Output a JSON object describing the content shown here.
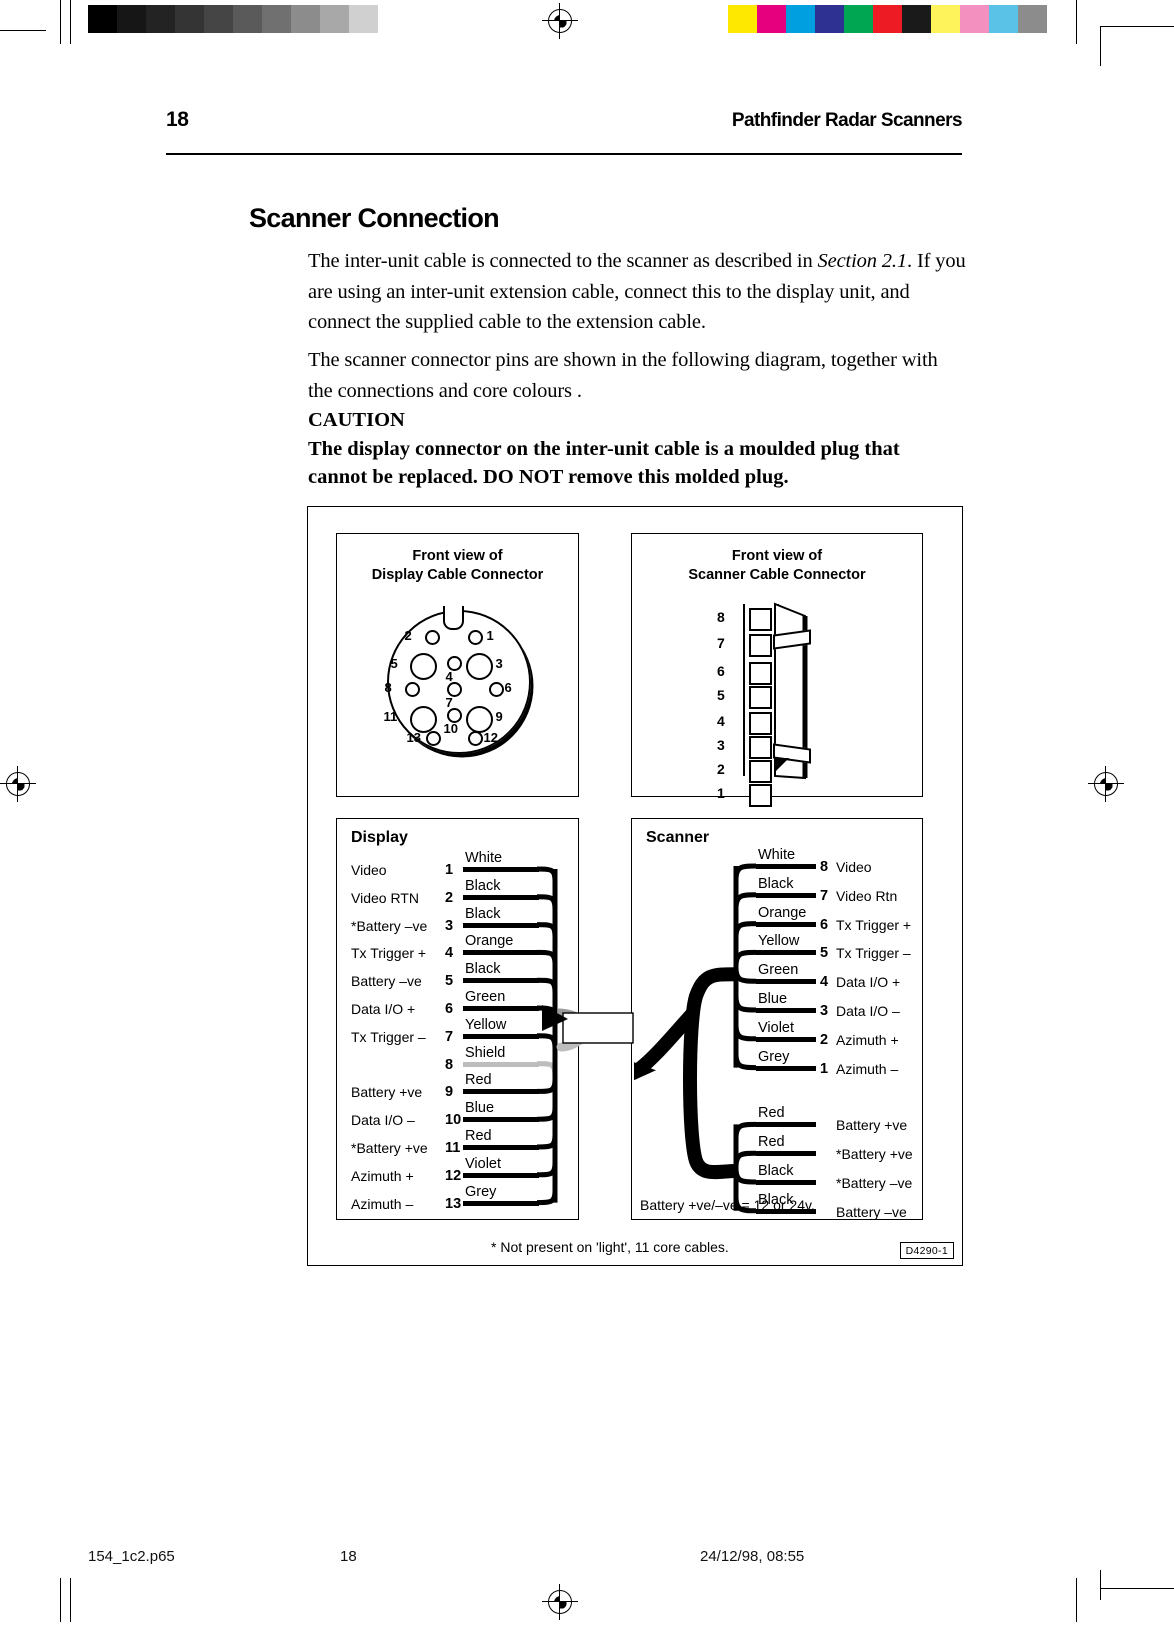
{
  "header": {
    "page_number": "18",
    "running_head": "Pathfinder Radar Scanners"
  },
  "section": {
    "title": "Scanner Connection",
    "paragraph_1_a": "The inter-unit cable is connected to the scanner as described in ",
    "paragraph_1_italic": "Section 2.1",
    "paragraph_1_b": ". If you are using an inter-unit extension cable, connect this to the display unit, and connect the supplied cable to the extension cable.",
    "paragraph_2": "The scanner connector pins  are shown in the following diagram, together with the connections and core colours .",
    "caution_heading": "CAUTION",
    "caution_line_1": "The display connector on the inter-unit cable is a moulded plug that",
    "caution_line_2": "cannot be replaced. DO NOT remove this molded plug."
  },
  "figure": {
    "display_connector": {
      "title_line_1": "Front view of",
      "title_line_2": "Display Cable Connector",
      "pins": [
        "1",
        "2",
        "3",
        "4",
        "5",
        "6",
        "7",
        "8",
        "9",
        "10",
        "11",
        "12",
        "13"
      ]
    },
    "scanner_connector": {
      "title_line_1": "Front view of",
      "title_line_2": "Scanner Cable Connector",
      "pins": [
        "8",
        "7",
        "6",
        "5",
        "4",
        "3",
        "2",
        "1"
      ]
    },
    "display_block": {
      "title": "Display",
      "rows": [
        {
          "signal": "Video",
          "pin": "1",
          "colour": "White"
        },
        {
          "signal": "Video RTN",
          "pin": "2",
          "colour": "Black"
        },
        {
          "signal": "*Battery –ve",
          "pin": "3",
          "colour": "Black"
        },
        {
          "signal": "Tx Trigger +",
          "pin": "4",
          "colour": "Orange"
        },
        {
          "signal": "Battery –ve",
          "pin": "5",
          "colour": "Black"
        },
        {
          "signal": "Data I/O +",
          "pin": "6",
          "colour": "Green"
        },
        {
          "signal": "Tx Trigger –",
          "pin": "7",
          "colour": "Yellow"
        },
        {
          "signal": "",
          "pin": "8",
          "colour": "Shield"
        },
        {
          "signal": "Battery +ve",
          "pin": "9",
          "colour": "Red"
        },
        {
          "signal": "Data I/O –",
          "pin": "10",
          "colour": "Blue"
        },
        {
          "signal": "*Battery +ve",
          "pin": "11",
          "colour": "Red"
        },
        {
          "signal": "Azimuth +",
          "pin": "12",
          "colour": "Violet"
        },
        {
          "signal": "Azimuth –",
          "pin": "13",
          "colour": "Grey"
        }
      ]
    },
    "scanner_block": {
      "title": "Scanner",
      "rows": [
        {
          "colour": "White",
          "pin": "8",
          "signal": "Video"
        },
        {
          "colour": "Black",
          "pin": "7",
          "signal": "Video Rtn"
        },
        {
          "colour": "Orange",
          "pin": "6",
          "signal": "Tx Trigger +"
        },
        {
          "colour": "Yellow",
          "pin": "5",
          "signal": "Tx Trigger –"
        },
        {
          "colour": "Green",
          "pin": "4",
          "signal": "Data I/O +"
        },
        {
          "colour": "Blue",
          "pin": "3",
          "signal": "Data I/O –"
        },
        {
          "colour": "Violet",
          "pin": "2",
          "signal": "Azimuth +"
        },
        {
          "colour": "Grey",
          "pin": "1",
          "signal": "Azimuth –"
        }
      ],
      "power_rows": [
        {
          "colour": "Red",
          "signal": "Battery +ve"
        },
        {
          "colour": "Red",
          "signal": "*Battery +ve"
        },
        {
          "colour": "Black",
          "signal": "*Battery –ve"
        },
        {
          "colour": "Black",
          "signal": "Battery –ve"
        }
      ],
      "battery_note": "Battery +ve/–ve = 12 or 24v."
    },
    "footnote": "* Not present on 'light', 11 core cables.",
    "drawing_id": "D4290-1"
  },
  "footer": {
    "filename": "154_1c2.p65",
    "page": "18",
    "timestamp": "24/12/98, 08:55"
  },
  "colour_bar": [
    "#ffe800",
    "#e6007e",
    "#00a0e0",
    "#2e3192",
    "#00a651",
    "#ed1c24",
    "#1a1a1a",
    "#fff35c",
    "#f490c0",
    "#5bc2e7",
    "#8c8c8c"
  ],
  "grey_bar": [
    "#000000",
    "#161616",
    "#232323",
    "#343434",
    "#454545",
    "#5a5a5a",
    "#707070",
    "#8c8c8c",
    "#a8a8a8",
    "#d0d0d0"
  ]
}
